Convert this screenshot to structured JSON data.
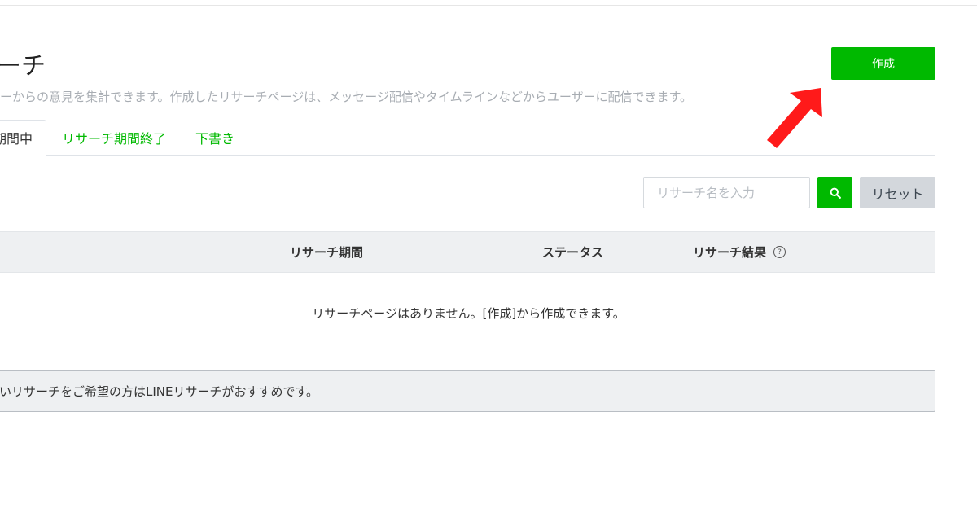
{
  "header": {
    "title": "ーチ",
    "description": "ーからの意見を集計できます。作成したリサーチページは、メッセージ配信やタイムラインなどからユーザーに配信できます。",
    "create_label": "作成"
  },
  "tabs": [
    {
      "label": "期間中",
      "active": true
    },
    {
      "label": "リサーチ期間終了",
      "active": false
    },
    {
      "label": "下書き",
      "active": false
    }
  ],
  "search": {
    "placeholder": "リサーチ名を入力",
    "value": "",
    "search_icon": "search-icon",
    "reset_label": "リセット"
  },
  "table": {
    "columns": [
      "リサーチ期間",
      "ステータス",
      "リサーチ結果"
    ],
    "help_icon": "question-circle-icon",
    "empty_message": "リサーチページはありません。[作成]から作成できます。"
  },
  "notice": {
    "prefix": "いリサーチをご希望の方は",
    "link": "LINEリサーチ",
    "suffix": "がおすすめです。"
  },
  "colors": {
    "accent": "#00b900",
    "arrow": "#ff0000",
    "header_bg": "#eef0f2"
  }
}
